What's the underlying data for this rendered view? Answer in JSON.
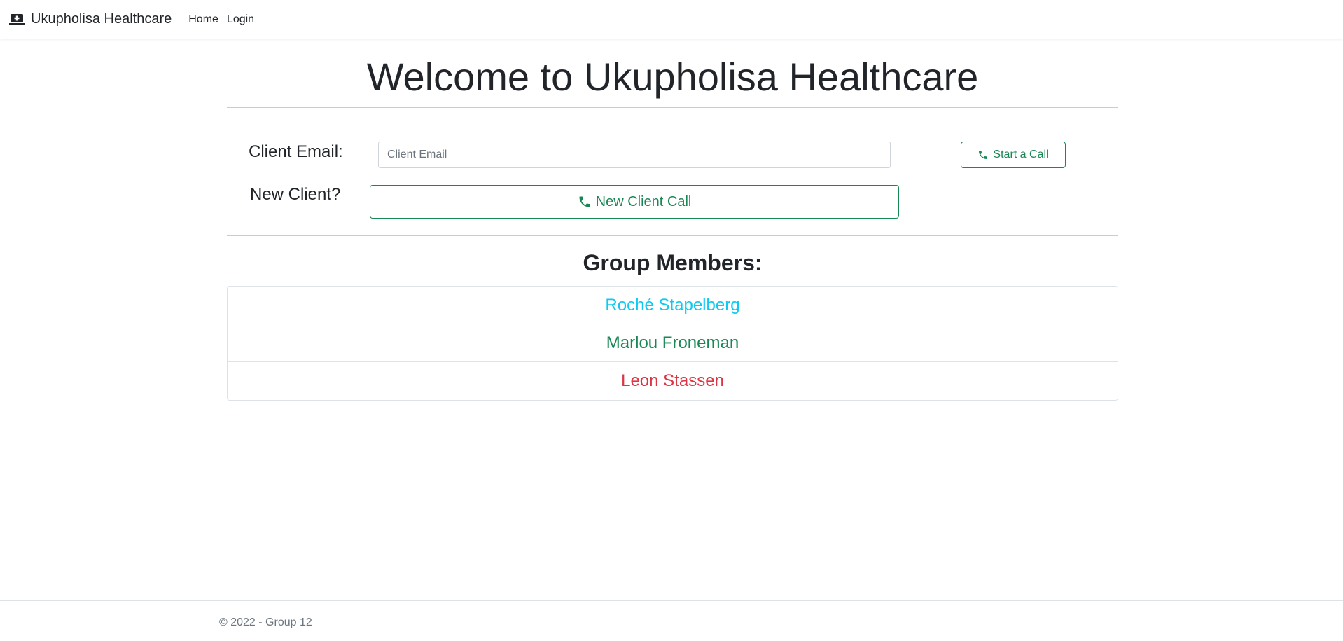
{
  "navbar": {
    "brand": "Ukupholisa Healthcare",
    "brand_icon": "laptop-medical-icon",
    "links": [
      {
        "label": "Home"
      },
      {
        "label": "Login"
      }
    ]
  },
  "main": {
    "title": "Welcome to Ukupholisa Healthcare",
    "email_label": "Client Email:",
    "email_placeholder": "Client Email",
    "email_value": "",
    "start_call_label": "Start a Call",
    "new_client_label": "New Client?",
    "new_client_call_label": "New Client Call",
    "phone_icon": "phone-icon",
    "accent_color": "#198754"
  },
  "group": {
    "title": "Group Members:",
    "members": [
      {
        "name": "Roché Stapelberg",
        "color": "#0dcaf0"
      },
      {
        "name": "Marlou Froneman",
        "color": "#198754"
      },
      {
        "name": "Leon Stassen",
        "color": "#dc3545"
      }
    ]
  },
  "footer": {
    "text": "© 2022 - Group 12"
  }
}
